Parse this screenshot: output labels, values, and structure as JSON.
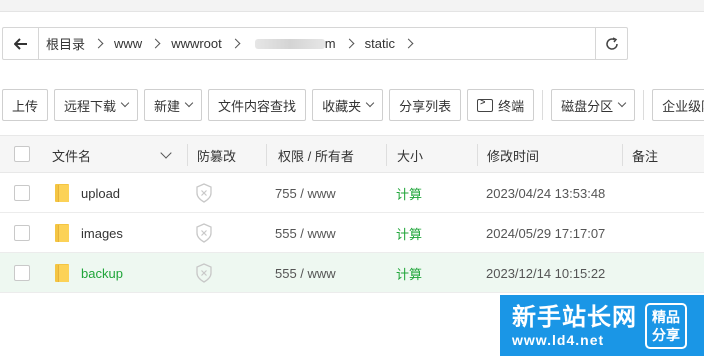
{
  "path": {
    "crumbs": [
      "根目录",
      "www",
      "wwwroot",
      "m",
      "static"
    ]
  },
  "toolbar": {
    "upload": "上传",
    "remote_download": "远程下载",
    "new": "新建",
    "content_search": "文件内容查找",
    "favorites": "收藏夹",
    "share_list": "分享列表",
    "terminal": "终端",
    "disk_partition": "磁盘分区",
    "enterprise": "企业级防"
  },
  "table": {
    "headers": {
      "name": "文件名",
      "tamper": "防篡改",
      "perm": "权限 / 所有者",
      "size": "大小",
      "mtime": "修改时间",
      "note": "备注"
    },
    "rows": [
      {
        "name": "upload",
        "perm": "755 / www",
        "size": "计算",
        "mtime": "2023/04/24 13:53:48"
      },
      {
        "name": "images",
        "perm": "555 / www",
        "size": "计算",
        "mtime": "2024/05/29 17:17:07"
      },
      {
        "name": "backup",
        "perm": "555 / www",
        "size": "计算",
        "mtime": "2023/12/14 10:15:22"
      }
    ]
  },
  "watermark": {
    "title": "新手站长网",
    "url": "www.ld4.net",
    "badge_line1": "精品",
    "badge_line2": "分享"
  }
}
